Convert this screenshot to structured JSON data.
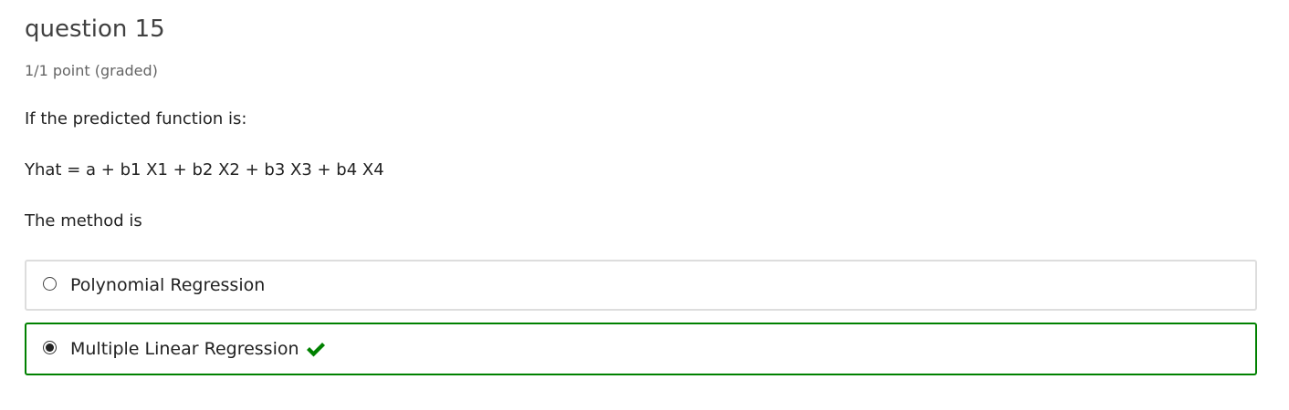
{
  "problem": {
    "title": "question 15",
    "progress": "1/1 point (graded)",
    "prompt": [
      "If the predicted function is:",
      "Yhat = a + b1 X1 + b2 X2 + b3 X3 + b4 X4",
      "The method is"
    ]
  },
  "choices": [
    {
      "label": "Polynomial Regression",
      "selected": false,
      "status": "unselected"
    },
    {
      "label": "Multiple Linear Regression",
      "selected": true,
      "status": "correct"
    }
  ],
  "colors": {
    "correct": "#008100",
    "default_border": "#dddddd",
    "text": "#222222",
    "muted": "#646464"
  },
  "icons": {
    "correct_marker": "checkmark-icon"
  }
}
